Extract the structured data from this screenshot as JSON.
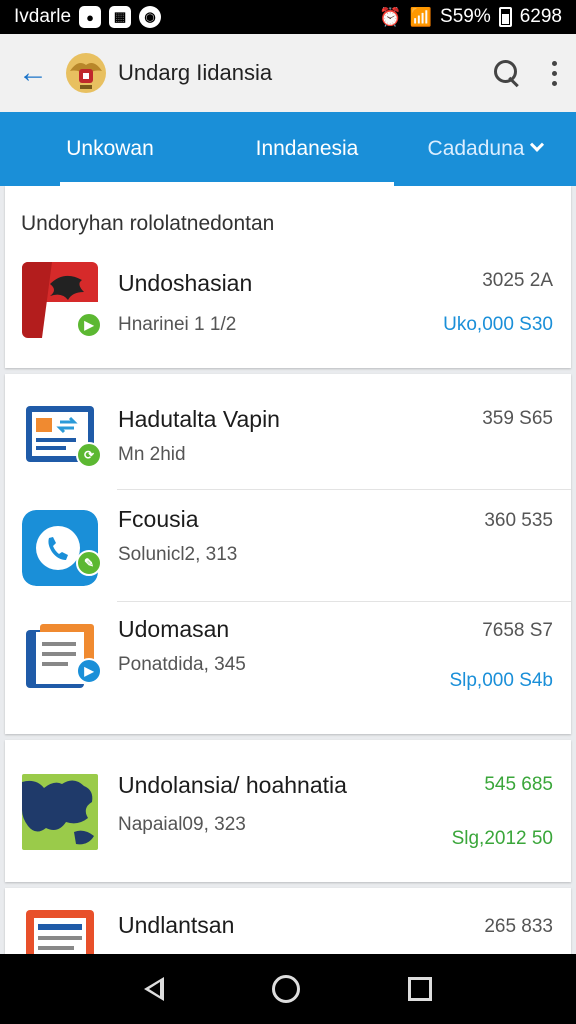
{
  "status_bar": {
    "carrier": "Ivdarle",
    "battery": "S59%",
    "time": "6298",
    "icons": [
      "chat-icon",
      "image-icon",
      "record-icon",
      "alarm-icon",
      "wifi-icon",
      "signal-icon",
      "battery-icon"
    ]
  },
  "app_bar": {
    "title": "Undarg Iidansia",
    "back_icon": "arrow-left-icon",
    "logo": "garuda-emblem-icon",
    "actions": [
      "search-icon",
      "more-vertical-icon"
    ]
  },
  "tabs": [
    {
      "label": "Unkowan",
      "active": true
    },
    {
      "label": "Inndanesia",
      "active": false
    },
    {
      "label": "Cadaduna",
      "active": false,
      "dropdown": true
    }
  ],
  "colors": {
    "tab_bar": "#1a8fd8",
    "accent_blue": "#1a8fd8",
    "accent_green": "#3aa63a"
  },
  "section": {
    "title": "Undoryhan rololatnedontan"
  },
  "items": [
    {
      "title": "Undoshasian",
      "subtitle": "Hnarinei 1 1/2",
      "number": "3025 2A",
      "amount": "Uko,000 S30",
      "amount_color": "#1a8fd8",
      "icon": "flag-eagle-icon",
      "badge_icon": "play-icon"
    },
    {
      "title": "Hadutalta Vapin",
      "subtitle": "Mn 2hid",
      "number": "359 S65",
      "amount": "",
      "icon": "card-icon",
      "badge_icon": "sync-icon"
    },
    {
      "title": "Fcousia",
      "subtitle": "Solunicl2, 313",
      "number": "360 535",
      "amount": "",
      "icon": "phone-icon",
      "badge_icon": "edit-icon"
    },
    {
      "title": "Udomasan",
      "subtitle": "Ponatdida, 345",
      "number": "7658 S7",
      "amount": "Slp,000 S4b",
      "amount_color": "#1a8fd8",
      "icon": "document-icon",
      "badge_icon": "play-icon"
    },
    {
      "title": "Undolansia/ hoahnatia",
      "subtitle": "Napaial09, 323",
      "number": "545 685",
      "number_color": "#3aa63a",
      "amount": "Slg,2012 50",
      "amount_color": "#3aa63a",
      "icon": "map-icon"
    },
    {
      "title": "Undlantsan",
      "subtitle": "",
      "number": "265 833",
      "amount": "",
      "icon": "newspaper-icon"
    }
  ],
  "nav_bar": [
    "back-icon",
    "home-icon",
    "recents-icon"
  ]
}
